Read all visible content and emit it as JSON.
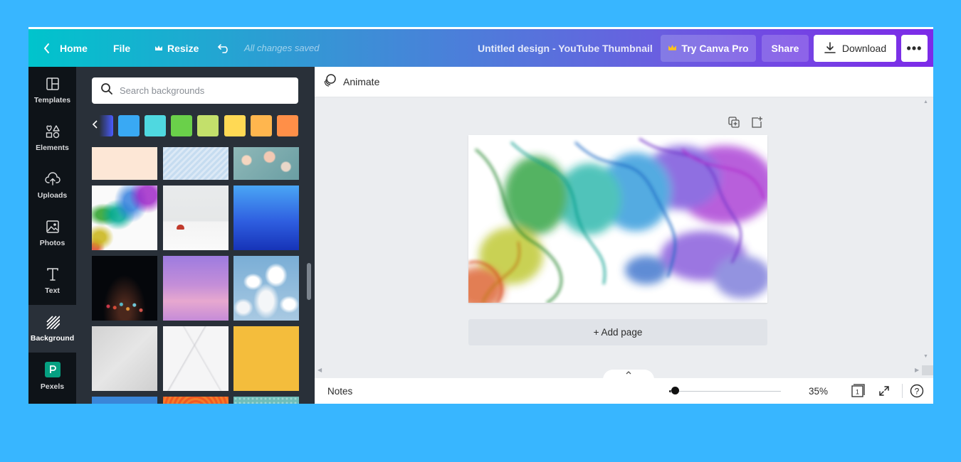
{
  "topbar": {
    "home": "Home",
    "file": "File",
    "resize": "Resize",
    "saved_status": "All changes saved",
    "design_title": "Untitled design - YouTube Thumbnail",
    "try_pro": "Try Canva Pro",
    "share": "Share",
    "download": "Download",
    "more": "•••"
  },
  "rail": {
    "items": [
      {
        "label": "Templates",
        "icon": "templates-icon"
      },
      {
        "label": "Elements",
        "icon": "elements-icon"
      },
      {
        "label": "Uploads",
        "icon": "uploads-icon"
      },
      {
        "label": "Photos",
        "icon": "photos-icon"
      },
      {
        "label": "Text",
        "icon": "text-icon"
      },
      {
        "label": "Background",
        "icon": "background-icon",
        "active": true
      },
      {
        "label": "Pexels",
        "icon": "pexels-icon"
      }
    ]
  },
  "panel": {
    "search_placeholder": "Search backgrounds",
    "swatches": [
      "#39a9f4",
      "#4fd8e0",
      "#6ad04a",
      "#c3e06b",
      "#ffd954",
      "#ffb64e",
      "#ff8f48"
    ],
    "thumbnails": [
      {
        "name": "peach-solid"
      },
      {
        "name": "light-blue-stripes"
      },
      {
        "name": "teal-bokeh"
      },
      {
        "name": "rainbow-smoke"
      },
      {
        "name": "ladybug-white"
      },
      {
        "name": "blue-gradient"
      },
      {
        "name": "dark-lights"
      },
      {
        "name": "pink-clouds"
      },
      {
        "name": "sky-clouds"
      },
      {
        "name": "grey-texture"
      },
      {
        "name": "white-marble"
      },
      {
        "name": "yellow-solid"
      },
      {
        "name": "blue-partial"
      },
      {
        "name": "orange-pattern"
      },
      {
        "name": "teal-dots"
      }
    ]
  },
  "editor": {
    "animate": "Animate",
    "add_page": "+ Add page",
    "notes": "Notes",
    "zoom": "35%",
    "zoom_level": 0.04,
    "page_count": "1",
    "help": "?"
  },
  "colors": {
    "topbar_start": "#00c4cc",
    "topbar_end": "#7d2ae8",
    "rail_bg": "#0e1318",
    "panel_bg": "#293039",
    "page_bg": "#38b6ff"
  }
}
